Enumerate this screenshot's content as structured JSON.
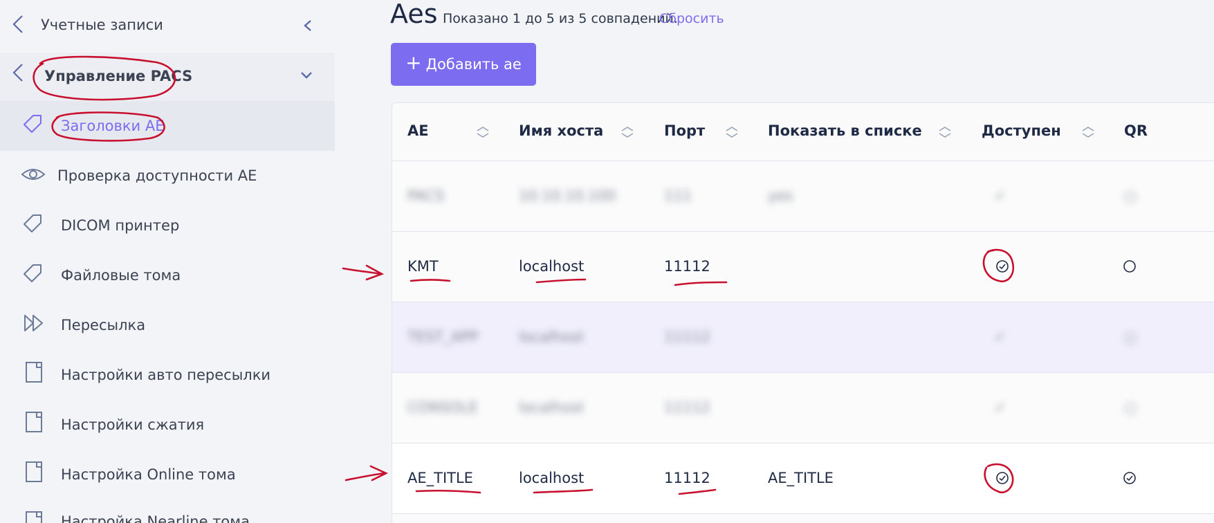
{
  "sidebar": {
    "accounts": {
      "label": "Учетные записи",
      "icon": "chevron-left-icon"
    },
    "pacs": {
      "label": "Управление PACS",
      "icon": "chevron-left-icon"
    },
    "items": [
      {
        "label": "Заголовки AE",
        "icon": "tag-icon",
        "active": true
      },
      {
        "label": "Проверка доступности AE",
        "icon": "eye-icon"
      },
      {
        "label": "DICOM принтер",
        "icon": "tag-icon"
      },
      {
        "label": "Файловые тома",
        "icon": "tag-icon"
      },
      {
        "label": "Пересылка",
        "icon": "fast-forward-icon"
      },
      {
        "label": "Настройки авто пересылки",
        "icon": "document-icon"
      },
      {
        "label": "Настройки сжатия",
        "icon": "document-icon"
      },
      {
        "label": "Настройка Online тома",
        "icon": "document-icon"
      },
      {
        "label": "Настройка Nearline тома",
        "icon": "document-icon"
      }
    ]
  },
  "main": {
    "title": "Aes",
    "summary": "Показано 1 до 5 из 5 совпадений.",
    "reset": "Сбросить",
    "add_button": "Добавить ae",
    "add_icon": "+"
  },
  "table": {
    "columns": [
      "AE",
      "Имя хоста",
      "Порт",
      "Показать в списке",
      "Доступен",
      "QR"
    ],
    "rows": [
      {
        "ae": "PACS",
        "host": "10.10.10.100",
        "port": "111",
        "list": "yes",
        "available": "✓",
        "qr": "○",
        "blurred": true
      },
      {
        "ae": "KMT",
        "host": "localhost",
        "port": "11112",
        "list": "",
        "available": true,
        "qr": false,
        "blurred": false
      },
      {
        "ae": "TEST_APP",
        "host": "localhost",
        "port": "11112",
        "list": "",
        "available": "✓",
        "qr": "○",
        "blurred": true
      },
      {
        "ae": "CONSOLE",
        "host": "localhost",
        "port": "11112",
        "list": "",
        "available": "✓",
        "qr": "○",
        "blurred": true
      },
      {
        "ae": "AE_TITLE",
        "host": "localhost",
        "port": "11112",
        "list": "AE_TITLE",
        "available": true,
        "qr": true,
        "blurred": false
      }
    ]
  },
  "colors": {
    "accent": "#7c6cf0",
    "annotation": "#c8102e",
    "text": "#1f2a44"
  }
}
